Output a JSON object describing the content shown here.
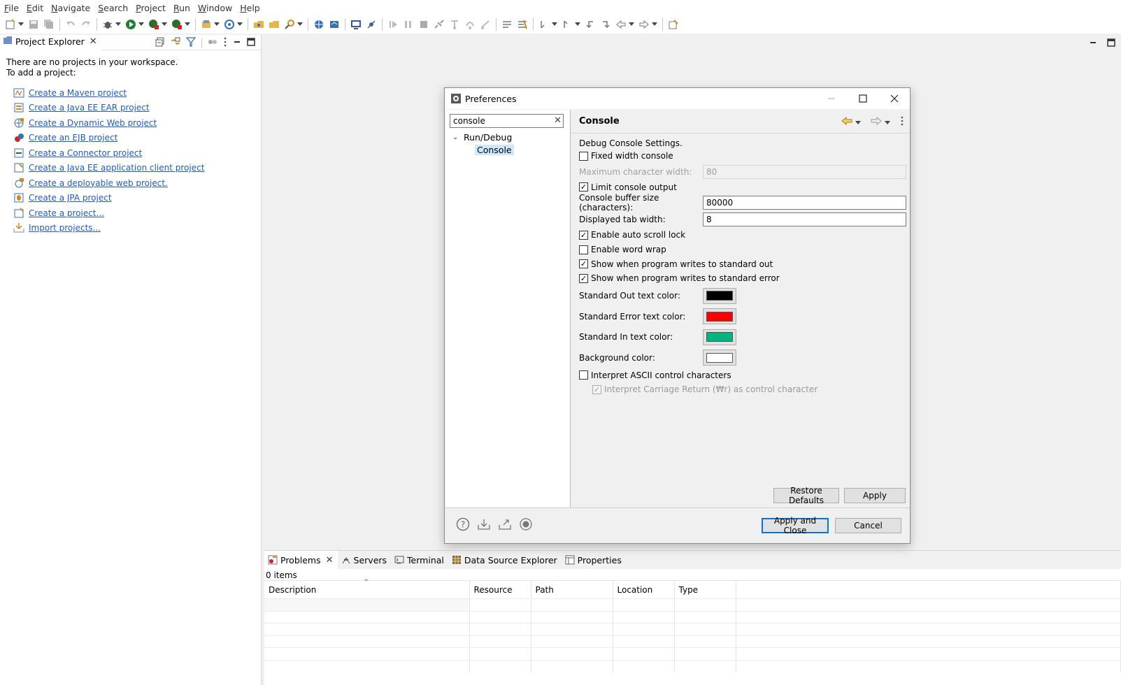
{
  "menubar": {
    "items": [
      {
        "mn": "F",
        "rest": "ile"
      },
      {
        "mn": "E",
        "rest": "dit"
      },
      {
        "mn": "N",
        "rest": "avigate"
      },
      {
        "mn": "S",
        "rest": "earch"
      },
      {
        "mn": "P",
        "rest": "roject"
      },
      {
        "mn": "R",
        "rest": "un"
      },
      {
        "mn": "W",
        "rest": "indow"
      },
      {
        "mn": "H",
        "rest": "elp"
      }
    ]
  },
  "project_explorer": {
    "tab_label": "Project Explorer",
    "message_line1": "There are no projects in your workspace.",
    "message_line2": "To add a project:",
    "links": [
      "Create a Maven project",
      "Create a Java EE EAR project",
      "Create a Dynamic Web project",
      "Create an EJB project",
      "Create a Connector project",
      "Create a Java EE application client project",
      "Create a deployable web project.",
      "Create a JPA project",
      "Create a project...",
      "Import projects..."
    ]
  },
  "bottom_panel": {
    "tabs": [
      "Problems",
      "Servers",
      "Terminal",
      "Data Source Explorer",
      "Properties"
    ],
    "items_count": "0 items",
    "columns": [
      "Description",
      "Resource",
      "Path",
      "Location",
      "Type"
    ]
  },
  "dialog": {
    "title": "Preferences",
    "filter_value": "console",
    "tree": {
      "parent": "Run/Debug",
      "child": "Console"
    },
    "page_title": "Console",
    "description": "Debug Console Settings.",
    "fixed_width_label": "Fixed width console",
    "fixed_width_checked": false,
    "max_width_label": "Maximum character width:",
    "max_width_value": "80",
    "limit_output_label": "Limit console output",
    "limit_output_checked": true,
    "buffer_label": "Console buffer size (characters):",
    "buffer_value": "80000",
    "tab_width_label": "Displayed tab width:",
    "tab_width_value": "8",
    "auto_scroll_label": "Enable auto scroll lock",
    "word_wrap_label": "Enable word wrap",
    "show_out_label": "Show when program writes to standard out",
    "show_err_label": "Show when program writes to standard error",
    "std_out_color_label": "Standard Out text color:",
    "std_err_color_label": "Standard Error text color:",
    "std_in_color_label": "Standard In text color:",
    "background_color_label": "Background color:",
    "colors": {
      "std_out": "#000000",
      "std_err": "#ff0000",
      "std_in": "#00b482",
      "background": "#ffffff"
    },
    "ascii_label": "Interpret ASCII control characters",
    "cr_label": "Interpret Carriage Return (₩r) as control character",
    "restore_defaults": "Restore Defaults",
    "apply": "Apply",
    "apply_and_close": "Apply and Close",
    "cancel": "Cancel"
  },
  "icons": {
    "help": "help-icon",
    "import": "import-icon",
    "export": "export-icon",
    "record": "record-icon"
  }
}
